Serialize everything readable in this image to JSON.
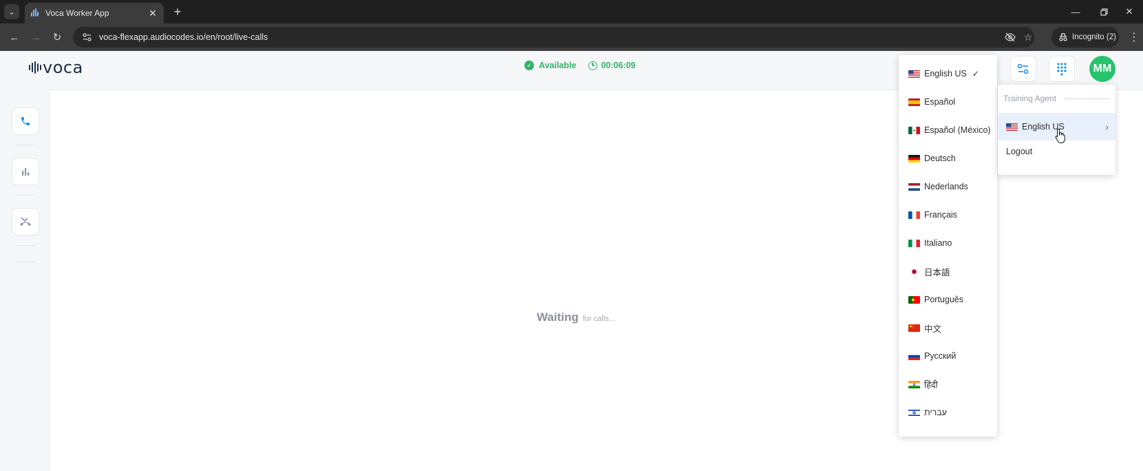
{
  "browser": {
    "tab_title": "Voca Worker App",
    "url": "voca-flexapp.audiocodes.io/en/root/live-calls",
    "incognito_label": "Incognito (2)"
  },
  "app": {
    "logo_text": "voca",
    "status": {
      "label": "Available",
      "timer": "00:06:09",
      "color": "#34b36a"
    },
    "avatar_initials": "MM",
    "avatar_color": "#27c46b",
    "waiting": {
      "big": "Waiting",
      "small": "for calls..."
    }
  },
  "language_menu": {
    "selected": "English US",
    "items": [
      {
        "label": "English US",
        "flag": "us"
      },
      {
        "label": "Español",
        "flag": "es"
      },
      {
        "label": "Español (México)",
        "flag": "mx"
      },
      {
        "label": "Deutsch",
        "flag": "de"
      },
      {
        "label": "Nederlands",
        "flag": "nl"
      },
      {
        "label": "Français",
        "flag": "fr"
      },
      {
        "label": "Italiano",
        "flag": "it"
      },
      {
        "label": "日本語",
        "flag": "jp"
      },
      {
        "label": "Português",
        "flag": "pt"
      },
      {
        "label": "中文",
        "flag": "cn"
      },
      {
        "label": "Русский",
        "flag": "ru"
      },
      {
        "label": "हिंदी",
        "flag": "in"
      },
      {
        "label": "עברית",
        "flag": "il"
      }
    ]
  },
  "profile_menu": {
    "role": "Training Agent",
    "language": "English US",
    "logout": "Logout"
  },
  "icons": {
    "sidebar": [
      "phone-icon",
      "bar-chart-icon",
      "missed-call-icon"
    ],
    "header": [
      "settings-sliders-icon",
      "dialpad-icon"
    ],
    "accent": "#1a8fe3"
  }
}
